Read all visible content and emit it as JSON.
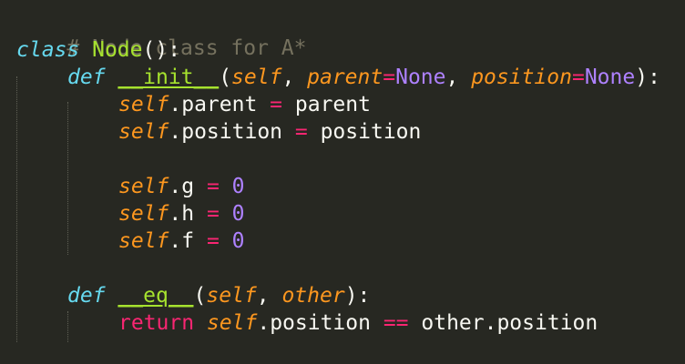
{
  "code": {
    "line1": {
      "comment": "# Node class for A*"
    },
    "line2": {
      "kw": "class",
      "name": "Node",
      "rest": "():"
    },
    "line3": {
      "kw": "def",
      "fn": "__init__",
      "p1": "(",
      "self": "self",
      "c1": ", ",
      "param1": "parent",
      "eq1": "=",
      "none1": "None",
      "c2": ", ",
      "param2": "position",
      "eq2": "=",
      "none2": "None",
      "end": "):"
    },
    "line4": {
      "self": "self",
      "attr": ".parent ",
      "op": "=",
      "val": " parent"
    },
    "line5": {
      "self": "self",
      "attr": ".position ",
      "op": "=",
      "val": " position"
    },
    "line7": {
      "self": "self",
      "attr": ".g ",
      "op": "=",
      "num": "0"
    },
    "line8": {
      "self": "self",
      "attr": ".h ",
      "op": "=",
      "num": "0"
    },
    "line9": {
      "self": "self",
      "attr": ".f ",
      "op": "=",
      "num": "0"
    },
    "line11": {
      "kw": "def",
      "fn": "__eq__",
      "p1": "(",
      "self": "self",
      "c1": ", ",
      "param1": "other",
      "end": "):"
    },
    "line12": {
      "ret": "return",
      "self": "self",
      "attr": ".position ",
      "op": "==",
      "val": " other.position"
    }
  },
  "colors": {
    "background": "#272822",
    "comment": "#75715e",
    "keyword": "#66d9ef",
    "function": "#a6e22e",
    "parameter": "#fd971f",
    "operator": "#f92672",
    "constant": "#ae81ff",
    "text": "#f8f8f2"
  }
}
